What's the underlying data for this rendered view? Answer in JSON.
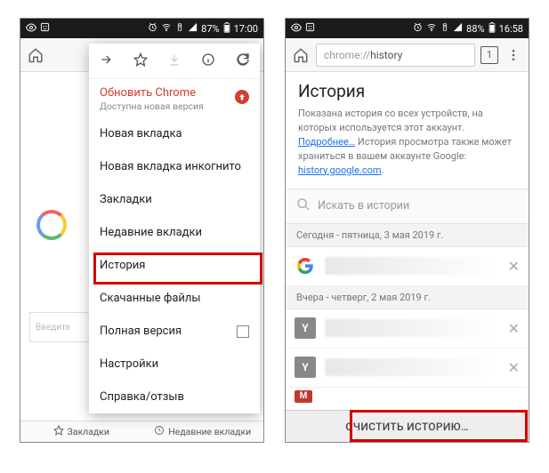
{
  "left": {
    "status": {
      "battery": "87%",
      "time": "17:00"
    },
    "omnibox": {
      "placeholder": ""
    },
    "background_search_placeholder": "Введите",
    "bottom": {
      "bookmarks": "Закладки",
      "recent": "Недавние вкладки"
    },
    "menu": {
      "update_title": "Обновить Chrome",
      "update_sub": "Доступна новая версия",
      "items": {
        "new_tab": "Новая вкладка",
        "incognito": "Новая вкладка инкогнито",
        "bookmarks": "Закладки",
        "recent": "Недавние вкладки",
        "history": "История",
        "downloads": "Скачанные файлы",
        "desktop": "Полная версия",
        "settings": "Настройки",
        "help": "Справка/отзыв"
      }
    }
  },
  "right": {
    "status": {
      "battery": "88%",
      "time": "16:58"
    },
    "url_prefix": "chrome://",
    "url_path": "history",
    "tab_count": "1",
    "title": "История",
    "desc_1": "Показана история со всех устройств, на которых используется этот аккаунт. ",
    "desc_link1": "Подробнее…",
    "desc_2": " История просмотра также может храниться в вашем аккаунте Google: ",
    "desc_link2": "history.google.com",
    "desc_3": ".",
    "search_placeholder": "Искать в истории",
    "date_today": "Сегодня - пятница, 3 мая 2019 г.",
    "date_yesterday": "Вчера - четверг, 2 мая 2019 г.",
    "clear_label": "ОЧИСТИТЬ ИСТОРИЮ…"
  }
}
